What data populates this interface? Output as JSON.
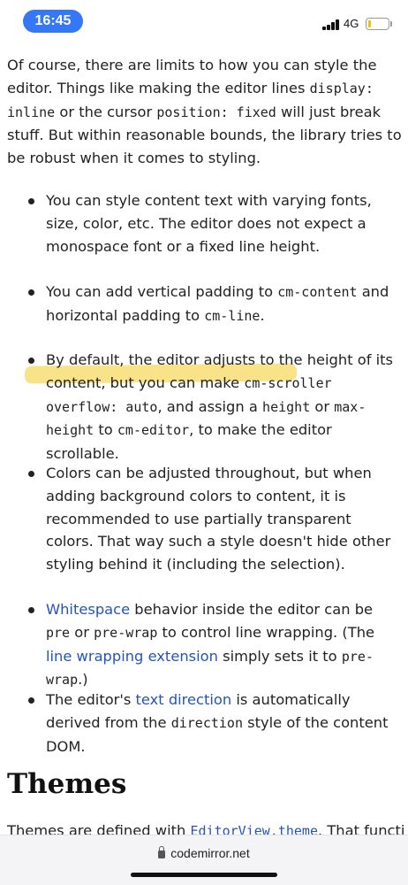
{
  "status_bar": {
    "time": "16:45",
    "network": "4G",
    "battery_color": "#f2c100"
  },
  "intro": {
    "t1": "Of course, there are limits to how you can style the editor. Things like making the editor lines ",
    "c1": "display: inline",
    "t2": " or the cursor ",
    "c2": "position: fixed",
    "t3": " will just break stuff. But within reasonable bounds, the library tries to be robust when it comes to styling."
  },
  "bullets": {
    "b1": {
      "text": "You can style content text with varying fonts, size, color, etc. The editor does not expect a monospace font or a fixed line height."
    },
    "b2": {
      "t1": "You can add vertical padding to ",
      "c1": "cm-content",
      "t2": " and horizontal padding to ",
      "c2": "cm-line",
      "t3": "."
    },
    "b3": {
      "t1": "By default, the editor adjusts to the height of its content, but you can make ",
      "c1": "cm-scroller",
      "t2": " ",
      "c2": "overflow: auto",
      "t3": ", and assign a ",
      "c3": "height",
      "t4": " or ",
      "c4": "max-height",
      "t5": " to ",
      "c5": "cm-editor",
      "t6": ", to make the editor scrollable."
    },
    "b4": {
      "text": "Colors can be adjusted throughout, but when adding background colors to content, it is recommended to use partially transparent colors. That way such a style doesn't hide other styling behind it (including the selection)."
    },
    "b5": {
      "link1": "Whitespace",
      "t1": " behavior inside the editor can be ",
      "c1": "pre",
      "t2": " or ",
      "c2": "pre-wrap",
      "t3": " to control line wrapping. (The ",
      "link2": "line wrapping extension",
      "t4": " simply sets it to ",
      "c3": "pre-wrap",
      "t5": ".)"
    },
    "b6": {
      "t1": "The editor's ",
      "link1": "text direction",
      "t2": " is automatically derived from the ",
      "c1": "direction",
      "t3": " style of the content DOM."
    }
  },
  "themes": {
    "heading": "Themes",
    "t1": "Themes are defined with ",
    "c1": "EditorView.theme",
    "t2": ". That function"
  },
  "url_bar": {
    "url": "codemirror.net"
  },
  "colors": {
    "link": "#2355b8",
    "highlight": "#f6dc6a",
    "time_pill": "#3478f6"
  }
}
